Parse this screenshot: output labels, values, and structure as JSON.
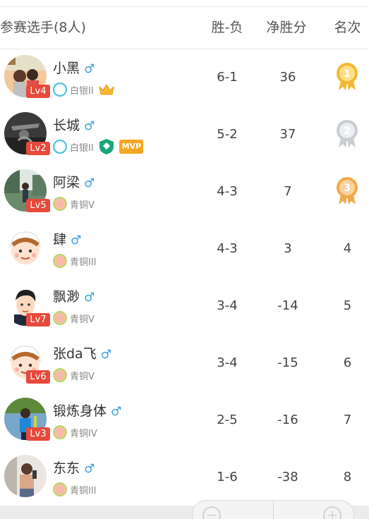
{
  "header": {
    "players_label": "参赛选手(8人)",
    "record_label": "胜-负",
    "net_label": "净胜分",
    "rank_label": "名次"
  },
  "players": [
    {
      "name": "小黑",
      "gender": "♂",
      "level": "Lv4",
      "tier": "白银II",
      "tier_type": "silver",
      "record": "6-1",
      "net": "36",
      "rank": "1",
      "medal": "gold",
      "badges": [
        "crown"
      ],
      "avatar": "photo-couple"
    },
    {
      "name": "长城",
      "gender": "♂",
      "level": "Lv2",
      "tier": "白银II",
      "tier_type": "silver",
      "record": "5-2",
      "net": "37",
      "rank": "2",
      "medal": "silver",
      "badges": [
        "shield",
        "mvp"
      ],
      "avatar": "photo-dark"
    },
    {
      "name": "阿梁",
      "gender": "♂",
      "level": "Lv5",
      "tier": "青铜V",
      "tier_type": "bronze",
      "record": "4-3",
      "net": "7",
      "rank": "3",
      "medal": "bronze",
      "badges": [],
      "avatar": "photo-outdoor"
    },
    {
      "name": "肆",
      "gender": "♂",
      "level": "",
      "tier": "青铜III",
      "tier_type": "bronze",
      "record": "4-3",
      "net": "3",
      "rank": "4",
      "medal": "",
      "badges": [],
      "avatar": "cartoon-boy"
    },
    {
      "name": "飘渺",
      "gender": "♂",
      "level": "Lv7",
      "tier": "青铜V",
      "tier_type": "bronze",
      "record": "3-4",
      "net": "-14",
      "rank": "5",
      "medal": "",
      "badges": [],
      "avatar": "cartoon-man"
    },
    {
      "name": "张da飞",
      "gender": "♂",
      "level": "Lv6",
      "tier": "青铜V",
      "tier_type": "bronze",
      "record": "3-4",
      "net": "-15",
      "rank": "6",
      "medal": "",
      "badges": [],
      "avatar": "cartoon-boy"
    },
    {
      "name": "锻炼身体",
      "gender": "♂",
      "level": "Lv3",
      "tier": "青铜IV",
      "tier_type": "bronze",
      "record": "2-5",
      "net": "-16",
      "rank": "7",
      "medal": "",
      "badges": [],
      "avatar": "photo-sport"
    },
    {
      "name": "东东",
      "gender": "♂",
      "level": "",
      "tier": "青铜III",
      "tier_type": "bronze",
      "record": "1-6",
      "net": "-38",
      "rank": "8",
      "medal": "",
      "badges": [],
      "avatar": "photo-shirtless"
    }
  ],
  "mvp_label": "MVP",
  "stepper": {
    "minus": "−",
    "plus": "+"
  },
  "colors": {
    "level_badge": "#e64a3c",
    "gender": "#3a9fe0",
    "gold": "#f5b733",
    "silver": "#c8cdd2",
    "bronze": "#f0a94a",
    "mvp": "#f5a623",
    "shield": "#1aa67a"
  }
}
